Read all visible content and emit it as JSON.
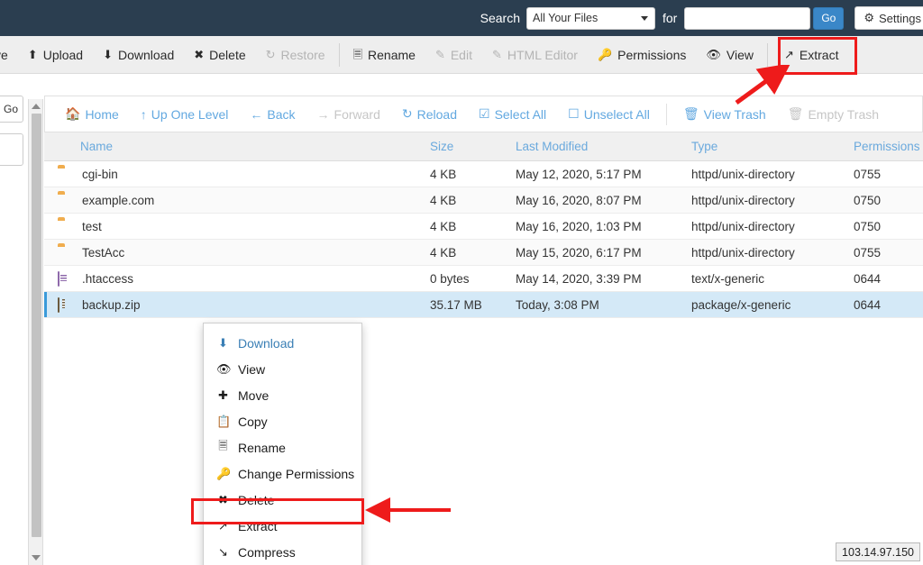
{
  "search": {
    "label": "Search",
    "scope_selected": "All Your Files",
    "for_label": "for",
    "query_value": "",
    "query_placeholder": "",
    "go_label": "Go",
    "settings_label": "Settings",
    "settings_icon": "gear-icon",
    "caret_icon": "chevron-down-icon",
    "accent_blue": "#3a87c8",
    "bar_bg": "#2b3e50"
  },
  "toolbar": {
    "items": [
      {
        "label": "ve",
        "icon": "save-icon",
        "disabled": false,
        "cropped": true
      },
      {
        "label": "Upload",
        "icon": "upload-icon",
        "disabled": false
      },
      {
        "label": "Download",
        "icon": "download-icon",
        "disabled": false
      },
      {
        "label": "Delete",
        "icon": "x-mark-icon",
        "disabled": false
      },
      {
        "label": "Restore",
        "icon": "restore-icon",
        "disabled": true
      },
      {
        "label": "Rename",
        "icon": "file-icon",
        "disabled": false
      },
      {
        "label": "Edit",
        "icon": "pencil-icon",
        "disabled": true
      },
      {
        "label": "HTML Editor",
        "icon": "html-editor-icon",
        "disabled": true
      },
      {
        "label": "Permissions",
        "icon": "key-icon",
        "disabled": false
      },
      {
        "label": "View",
        "icon": "eye-icon",
        "disabled": false
      },
      {
        "label": "Extract",
        "icon": "extract-icon",
        "disabled": false
      }
    ]
  },
  "sidebar": {
    "go_label": "Go"
  },
  "navbar": {
    "items": [
      {
        "label": "Home",
        "icon": "home-icon",
        "disabled": false
      },
      {
        "label": "Up One Level",
        "icon": "arrow-up-icon",
        "disabled": false
      },
      {
        "label": "Back",
        "icon": "arrow-left-icon",
        "disabled": false
      },
      {
        "label": "Forward",
        "icon": "arrow-right-icon",
        "disabled": true
      },
      {
        "label": "Reload",
        "icon": "reload-icon",
        "disabled": false
      },
      {
        "label": "Select All",
        "icon": "checkbox-checked-icon",
        "disabled": false
      },
      {
        "label": "Unselect All",
        "icon": "checkbox-empty-icon",
        "disabled": false
      },
      {
        "label": "View Trash",
        "icon": "trash-icon",
        "disabled": false
      },
      {
        "label": "Empty Trash",
        "icon": "trash-icon",
        "disabled": true
      }
    ]
  },
  "table": {
    "columns": [
      "Name",
      "Size",
      "Last Modified",
      "Type",
      "Permissions"
    ],
    "rows": [
      {
        "icon": "folder-icon",
        "name": "cgi-bin",
        "size": "4 KB",
        "modified": "May 12, 2020, 5:17 PM",
        "type": "httpd/unix-directory",
        "permissions": "0755",
        "selected": false
      },
      {
        "icon": "folder-icon",
        "name": "example.com",
        "size": "4 KB",
        "modified": "May 16, 2020, 8:07 PM",
        "type": "httpd/unix-directory",
        "permissions": "0750",
        "selected": false
      },
      {
        "icon": "folder-icon",
        "name": "test",
        "size": "4 KB",
        "modified": "May 16, 2020, 1:03 PM",
        "type": "httpd/unix-directory",
        "permissions": "0750",
        "selected": false
      },
      {
        "icon": "folder-icon",
        "name": "TestAcc",
        "size": "4 KB",
        "modified": "May 15, 2020, 6:17 PM",
        "type": "httpd/unix-directory",
        "permissions": "0755",
        "selected": false
      },
      {
        "icon": "document-icon",
        "name": ".htaccess",
        "size": "0 bytes",
        "modified": "May 14, 2020, 3:39 PM",
        "type": "text/x-generic",
        "permissions": "0644",
        "selected": false
      },
      {
        "icon": "zip-file-icon",
        "name": "backup.zip",
        "size": "35.17 MB",
        "modified": "Today, 3:08 PM",
        "type": "package/x-generic",
        "permissions": "0644",
        "selected": true
      }
    ]
  },
  "context_menu": {
    "items": [
      {
        "label": "Download",
        "icon": "download-icon",
        "style": "link"
      },
      {
        "label": "View",
        "icon": "eye-icon",
        "style": "normal"
      },
      {
        "label": "Move",
        "icon": "move-icon",
        "style": "normal"
      },
      {
        "label": "Copy",
        "icon": "copy-icon",
        "style": "normal"
      },
      {
        "label": "Rename",
        "icon": "file-icon",
        "style": "normal"
      },
      {
        "label": "Change Permissions",
        "icon": "key-icon",
        "style": "normal"
      },
      {
        "label": "Delete",
        "icon": "x-mark-icon",
        "style": "normal"
      },
      {
        "label": "Extract",
        "icon": "extract-icon",
        "style": "normal",
        "highlighted": true
      },
      {
        "label": "Compress",
        "icon": "compress-icon",
        "style": "normal"
      }
    ]
  },
  "annotations": {
    "highlight_color": "#ee1b1b",
    "boxes": [
      "toolbar-extract",
      "context-menu-extract"
    ],
    "arrows": [
      "arrow-to-toolbar-extract",
      "arrow-to-context-extract"
    ]
  },
  "status": {
    "ip_address": "103.14.97.150"
  }
}
